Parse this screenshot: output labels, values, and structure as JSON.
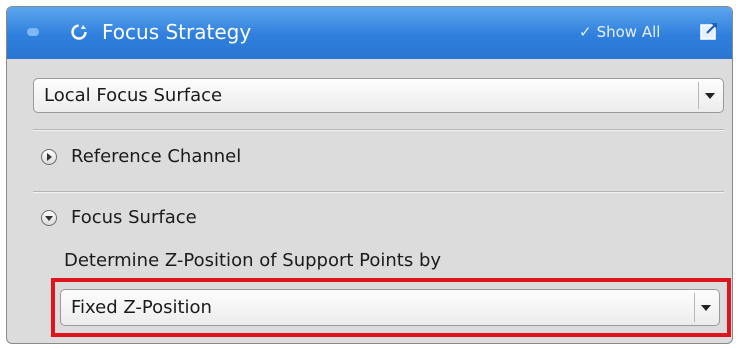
{
  "panel": {
    "title": "Focus Strategy",
    "show_all_label": "Show All",
    "header_color": "#2f7fdc",
    "icons": {
      "collapse": "collapse-dot-icon",
      "title": "cycle-icon",
      "show_all": "checkmark-icon",
      "popout": "popout-icon"
    }
  },
  "strategy_select": {
    "value": "Local Focus Surface"
  },
  "sections": [
    {
      "label": "Reference Channel",
      "expanded": false
    },
    {
      "label": "Focus Surface",
      "expanded": true
    }
  ],
  "focus_surface": {
    "support_points_label": "Determine Z-Position of Support Points by",
    "support_points_select": {
      "value": "Fixed Z-Position"
    },
    "highlight_color": "#e0151b"
  }
}
